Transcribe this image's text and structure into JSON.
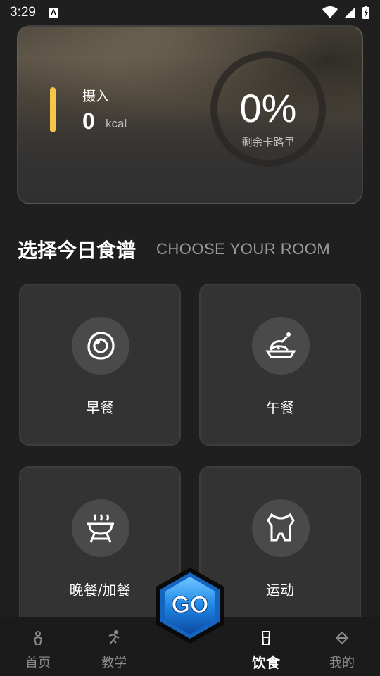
{
  "status_bar": {
    "time": "3:29",
    "badge": "A",
    "icons": [
      "wifi-icon",
      "signal-icon",
      "battery-charging-icon"
    ]
  },
  "summary": {
    "intake_label": "摄入",
    "intake_value": "0",
    "intake_unit": "kcal",
    "percent": "0%",
    "remaining_label": "剩余卡路里",
    "ring_progress": 0,
    "accent_color": "#f7c548"
  },
  "section": {
    "title": "选择今日食谱",
    "subtitle": "CHOOSE YOUR ROOM"
  },
  "meals": [
    {
      "label": "早餐",
      "icon": "fried-egg-icon"
    },
    {
      "label": "午餐",
      "icon": "roast-chicken-icon"
    },
    {
      "label": "晚餐/加餐",
      "icon": "grill-icon"
    },
    {
      "label": "运动",
      "icon": "fitness-shirt-icon"
    }
  ],
  "go_button": {
    "label": "GO"
  },
  "nav": [
    {
      "label": "首页",
      "icon": "home-figure-icon",
      "active": false
    },
    {
      "label": "教学",
      "icon": "running-icon",
      "active": false
    },
    {
      "label": "饮食",
      "icon": "cup-icon",
      "active": true
    },
    {
      "label": "我的",
      "icon": "profile-diamond-icon",
      "active": false
    }
  ]
}
